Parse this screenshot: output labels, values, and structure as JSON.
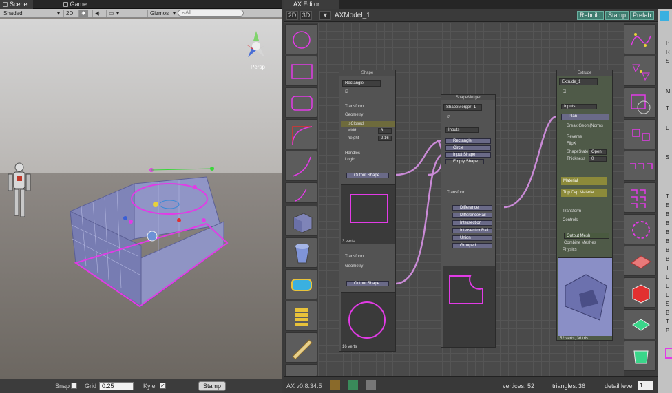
{
  "scene": {
    "tabs": [
      "Scene",
      "Game"
    ],
    "toolbar": {
      "shading": "Shaded",
      "mode_2d": "2D",
      "gizmos": "Gizmos",
      "search_placeholder": "All"
    },
    "persp_label": "Persp",
    "bottom": {
      "snap_label": "Snap",
      "grid_label": "Grid",
      "grid_value": "0.25",
      "kyle_label": "Kyle",
      "stamp_label": "Stamp"
    }
  },
  "editor": {
    "tab": "AX Editor",
    "view_2d": "2D",
    "view_3d": "3D",
    "model_name": "AXModel_1",
    "buttons": {
      "rebuild": "Rebuild",
      "stamp": "Stamp",
      "prefab": "Prefab"
    },
    "version": "AX v0.8.34.5",
    "stats": {
      "vertices_label": "vertices:",
      "vertices": "52",
      "triangles_label": "triangles:",
      "triangles": "36",
      "detail_label": "detail level",
      "detail": "1"
    },
    "nodes": {
      "shape": {
        "title": "Shape",
        "name1": "Rectangle",
        "transform": "Transform",
        "geometry": "Geometry",
        "is_closed": "isClosed",
        "width_label": "width",
        "width": "3",
        "height_label": "height",
        "height": "2.16",
        "handles": "Handles",
        "logic": "Logic",
        "output1": "Output Shape",
        "verts1": "3 verts",
        "transform2": "Transform",
        "geometry2": "Geometry",
        "output2": "Output Shape",
        "verts2": "16 verts"
      },
      "merger": {
        "title": "ShapeMerger",
        "name": "ShapeMerger_1",
        "inputs": "Inputs",
        "in_items": [
          "Rectangle",
          "Circle",
          "Input Shape",
          "Empty Shape"
        ],
        "transform": "Transform",
        "ops": [
          "Difference",
          "DifferenceRail",
          "Intersection",
          "IntersectionRail",
          "Union",
          "Grouped"
        ]
      },
      "extrude": {
        "title": "Extrude",
        "name": "Extrude_1",
        "inputs": "Inputs",
        "plan": "Plan",
        "break_geom": "Break Geom|Norms",
        "reverse": "Reverse",
        "flipx": "FlipX",
        "shape_state_label": "ShapeState",
        "shape_state": "Open",
        "thickness_label": "Thickness",
        "thickness": "0",
        "material": "Material",
        "top_cap": "Top Cap Material",
        "transform": "Transform",
        "controls": "Controls",
        "output_mesh": "Output Mesh",
        "combine": "Combine Meshes",
        "physics": "Physics",
        "stats": "52 verts, 36 tris"
      }
    }
  },
  "inspector": {
    "letters": [
      "P",
      "R",
      "S",
      "M",
      "T",
      "L",
      "S",
      "T",
      "E",
      "B",
      "B",
      "B",
      "B",
      "B",
      "B",
      "T",
      "L",
      "L",
      "L",
      "S",
      "B",
      "T",
      "B"
    ]
  },
  "colors": {
    "accent": "#e23be6",
    "teal": "#3d7b6e",
    "node_bg": "#535353",
    "grid": "#4a4a4a"
  }
}
